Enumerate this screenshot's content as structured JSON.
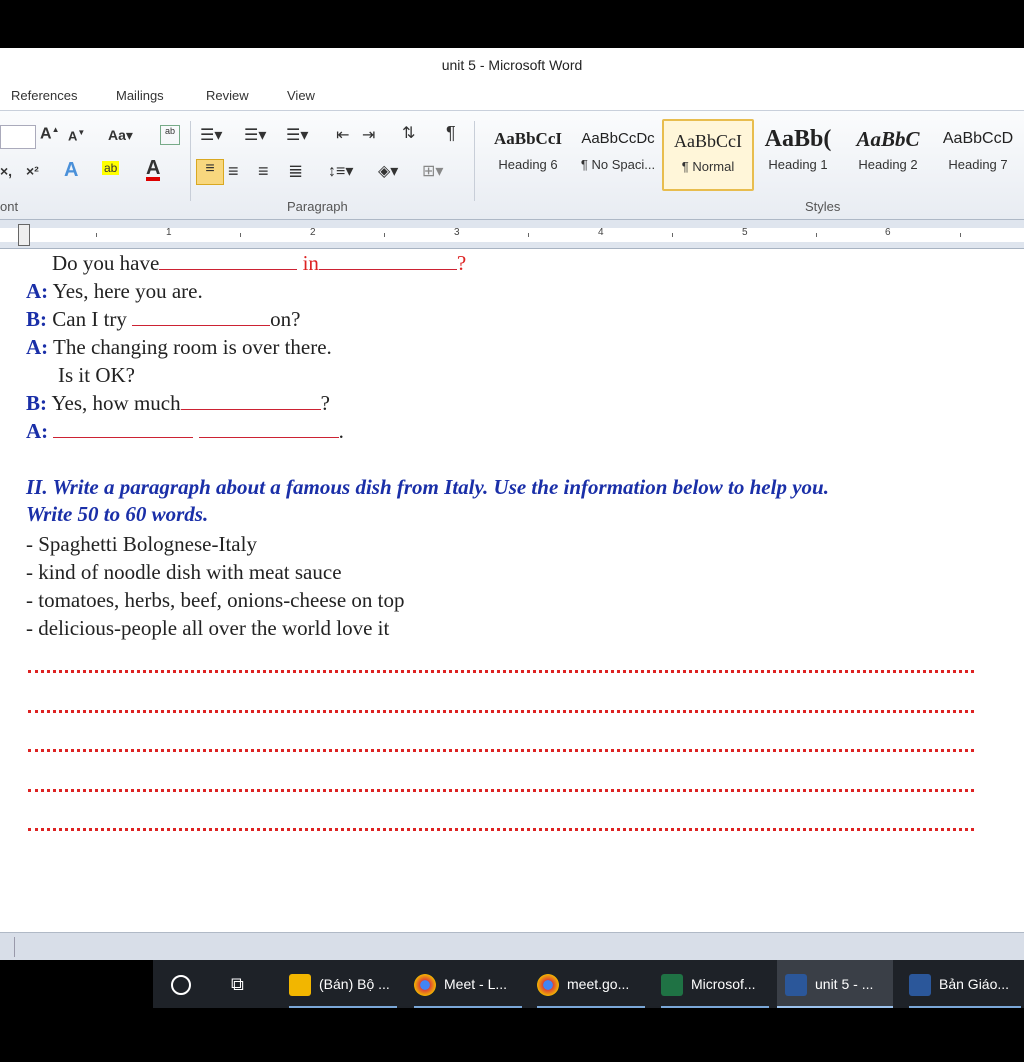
{
  "window": {
    "title": "unit 5 - Microsoft Word"
  },
  "ribbon_tabs": [
    "References",
    "Mailings",
    "Review",
    "View"
  ],
  "ribbon": {
    "font_group_label": "ont",
    "paragraph_group_label": "Paragraph",
    "styles_group_label": "Styles",
    "styles": [
      {
        "preview": "AaBbCcI",
        "name": "Heading 6"
      },
      {
        "preview": "AaBbCcDc",
        "name": "¶ No Spaci..."
      },
      {
        "preview": "AaBbCcI",
        "name": "¶ Normal"
      },
      {
        "preview": "AaBb(",
        "name": "Heading 1"
      },
      {
        "preview": "AaBbC",
        "name": "Heading 2"
      },
      {
        "preview": "AaBbCcD",
        "name": "Heading 7"
      }
    ],
    "selected_style": "¶ Normal"
  },
  "ruler": {
    "numbers": [
      "1",
      "2",
      "3",
      "4",
      "5",
      "6"
    ]
  },
  "document": {
    "line1_a": "Do you have",
    "line1_b": "in",
    "line1_c": "?",
    "dialog": [
      {
        "speaker": "A:",
        "text": "Yes, here you are."
      },
      {
        "speaker": "B:",
        "text_a": "Can I try",
        "text_b": "on?"
      },
      {
        "speaker": "A:",
        "text": "The changing room is over there."
      },
      {
        "speaker": "",
        "text": "Is it OK?"
      },
      {
        "speaker": "B:",
        "text_a": "Yes, how much",
        "text_b": "?"
      },
      {
        "speaker": "A:",
        "text_b": "."
      }
    ],
    "heading_line1": "II. Write a paragraph about a famous dish from Italy. Use the information below to help you.",
    "heading_line2": "Write 50 to 60 words.",
    "bullets": [
      "- Spaghetti Bolognese-Italy",
      "- kind of noodle dish with meat sauce",
      "- tomatoes, herbs, beef, onions-cheese on top",
      "- delicious-people all over the world love it"
    ],
    "answer_line_count": 5
  },
  "taskbar": {
    "items": [
      {
        "label": "(Bán) Bộ ...",
        "icon": "folder-icon",
        "color": "#f2b600"
      },
      {
        "label": "Meet - L...",
        "icon": "chrome-icon",
        "color": "#db4437"
      },
      {
        "label": "meet.go...",
        "icon": "chrome-icon",
        "color": "#db4437"
      },
      {
        "label": "Microsof...",
        "icon": "excel-icon",
        "color": "#1f7244"
      },
      {
        "label": "unit 5 - ...",
        "icon": "word-icon",
        "color": "#2b579a"
      },
      {
        "label": "Bản Giáo...",
        "icon": "word-icon",
        "color": "#2b579a"
      }
    ]
  }
}
